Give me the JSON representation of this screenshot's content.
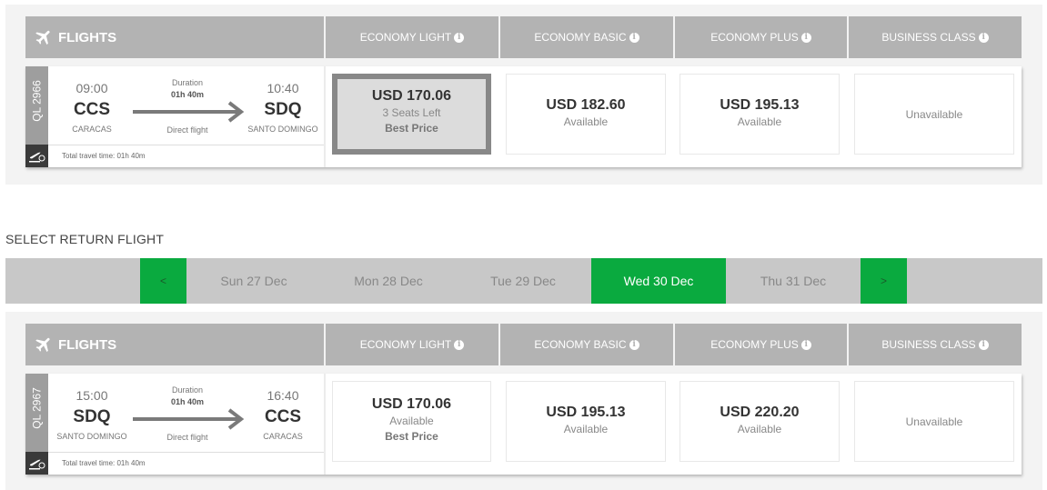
{
  "colors": {
    "header_gray": "#b3b3b3",
    "accent_green": "#0aaa3f",
    "date_bar": "#c8c8c8",
    "best_border": "#888888"
  },
  "outbound": {
    "header": {
      "flights_label": "FLIGHTS",
      "classes": [
        "ECONOMY LIGHT",
        "ECONOMY BASIC",
        "ECONOMY PLUS",
        "BUSINESS CLASS"
      ]
    },
    "flight": {
      "number": "QL 2966",
      "depart_time": "09:00",
      "depart_code": "CCS",
      "depart_city": "CARACAS",
      "arrive_time": "10:40",
      "arrive_code": "SDQ",
      "arrive_city": "SANTO DOMINGO",
      "duration_label": "Duration",
      "duration": "01h 40m",
      "direct": "Direct flight",
      "total": "Total travel time: 01h 40m"
    },
    "fares": [
      {
        "price": "USD 170.06",
        "sub": "3 Seats Left",
        "best": "Best Price"
      },
      {
        "price": "USD 182.60",
        "sub": "Available"
      },
      {
        "price": "USD 195.13",
        "sub": "Available"
      },
      {
        "unavailable": "Unavailable"
      }
    ]
  },
  "return_title": "SELECT RETURN FLIGHT",
  "date_bar": {
    "prev": "<",
    "next": ">",
    "dates": [
      "Sun 27 Dec",
      "Mon 28 Dec",
      "Tue 29 Dec",
      "Wed 30 Dec",
      "Thu 31 Dec"
    ],
    "selected": "Wed 30 Dec"
  },
  "return": {
    "header": {
      "flights_label": "FLIGHTS",
      "classes": [
        "ECONOMY LIGHT",
        "ECONOMY BASIC",
        "ECONOMY PLUS",
        "BUSINESS CLASS"
      ]
    },
    "flight": {
      "number": "QL 2967",
      "depart_time": "15:00",
      "depart_code": "SDQ",
      "depart_city": "SANTO DOMINGO",
      "arrive_time": "16:40",
      "arrive_code": "CCS",
      "arrive_city": "CARACAS",
      "duration_label": "Duration",
      "duration": "01h 40m",
      "direct": "Direct flight",
      "total": "Total travel time: 01h 40m"
    },
    "fares": [
      {
        "price": "USD 170.06",
        "sub": "Available",
        "best": "Best Price"
      },
      {
        "price": "USD 195.13",
        "sub": "Available"
      },
      {
        "price": "USD 220.20",
        "sub": "Available"
      },
      {
        "unavailable": "Unavailable"
      }
    ]
  }
}
